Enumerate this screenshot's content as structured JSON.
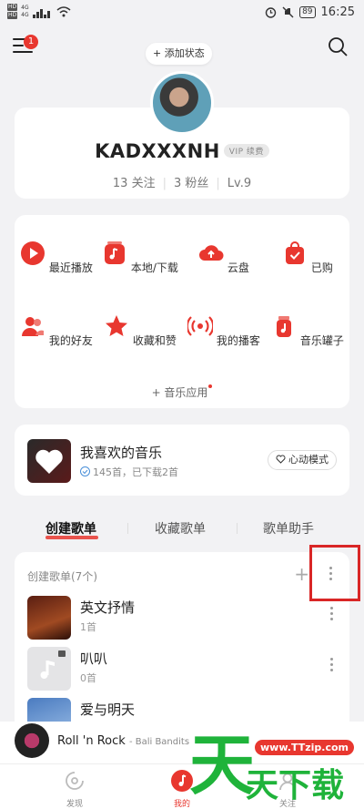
{
  "status_bar": {
    "hd_top": "HD",
    "hd_bottom": "HD",
    "signal_1": "4G",
    "signal_2": "4G",
    "battery": "89",
    "time": "16:25"
  },
  "header": {
    "menu_badge": "1",
    "add_status": "+ 添加状态"
  },
  "profile": {
    "username": "KADXXXNH",
    "vip_label": "VIP 续费",
    "follow": "13 关注",
    "fans": "3 粉丝",
    "level": "Lv.9"
  },
  "grid": {
    "items": [
      {
        "label": "最近播放",
        "icon": "play-icon"
      },
      {
        "label": "本地/下载",
        "icon": "local-music-icon"
      },
      {
        "label": "云盘",
        "icon": "cloud-icon"
      },
      {
        "label": "已购",
        "icon": "purchased-icon"
      },
      {
        "label": "我的好友",
        "icon": "friends-icon"
      },
      {
        "label": "收藏和赞",
        "icon": "star-icon"
      },
      {
        "label": "我的播客",
        "icon": "podcast-icon"
      },
      {
        "label": "音乐罐子",
        "icon": "music-jar-icon"
      }
    ],
    "music_app": "+ 音乐应用"
  },
  "liked": {
    "title": "我喜欢的音乐",
    "subtitle": "145首，已下载2首",
    "mode": "心动模式"
  },
  "tabs": [
    {
      "label": "创建歌单",
      "active": true
    },
    {
      "label": "收藏歌单",
      "active": false
    },
    {
      "label": "歌单助手",
      "active": false
    }
  ],
  "playlists": {
    "header": "创建歌单(7个)",
    "items": [
      {
        "name": "英文抒情",
        "count": "1首"
      },
      {
        "name": "叭叭",
        "count": "0首"
      },
      {
        "name": "爱与明天",
        "count": ""
      }
    ]
  },
  "mini_player": {
    "title": "Roll 'n Rock",
    "artist": "- Bali Bandits"
  },
  "bottom_nav": [
    {
      "label": "发现",
      "active": false
    },
    {
      "label": "我的",
      "active": true
    },
    {
      "label": "关注",
      "active": false
    }
  ],
  "watermark": {
    "url": "www.TTzip.com",
    "big_1": "天",
    "big_2": "天下载"
  },
  "colors": {
    "accent": "#e8372f",
    "highlight_box": "#d92626",
    "watermark_green": "#1fb33a"
  }
}
